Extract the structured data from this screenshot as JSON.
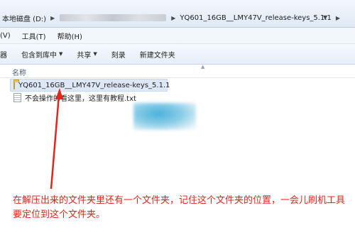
{
  "address_bar": {
    "drive": "本地磁盘 (D:)",
    "folder": "YQ601_16GB__LMY47V_release-keys_5.1.1"
  },
  "menu_bar": {
    "items": [
      "(V)",
      "工具(T)",
      "帮助(H)"
    ]
  },
  "toolbar": {
    "items": [
      {
        "label": "器",
        "dropdown": false
      },
      {
        "label": "包含到库中",
        "dropdown": true
      },
      {
        "label": "共享",
        "dropdown": true
      },
      {
        "label": "刻录",
        "dropdown": false
      },
      {
        "label": "新建文件夹",
        "dropdown": false
      }
    ]
  },
  "file_list": {
    "column_name": "名称",
    "rows": [
      {
        "name": "YQ601_16GB__LMY47V_release-keys_5.1.1",
        "type": "folder"
      },
      {
        "name": "不会操作的看这里，这里有教程.txt",
        "type": "txt"
      }
    ]
  },
  "annotation": {
    "text": "在解压出来的文件夹里还有一个文件夹，记住这个文件夹的位置，一会儿刷机工具要定位到这个文件夹。",
    "color": "#e5241b"
  }
}
